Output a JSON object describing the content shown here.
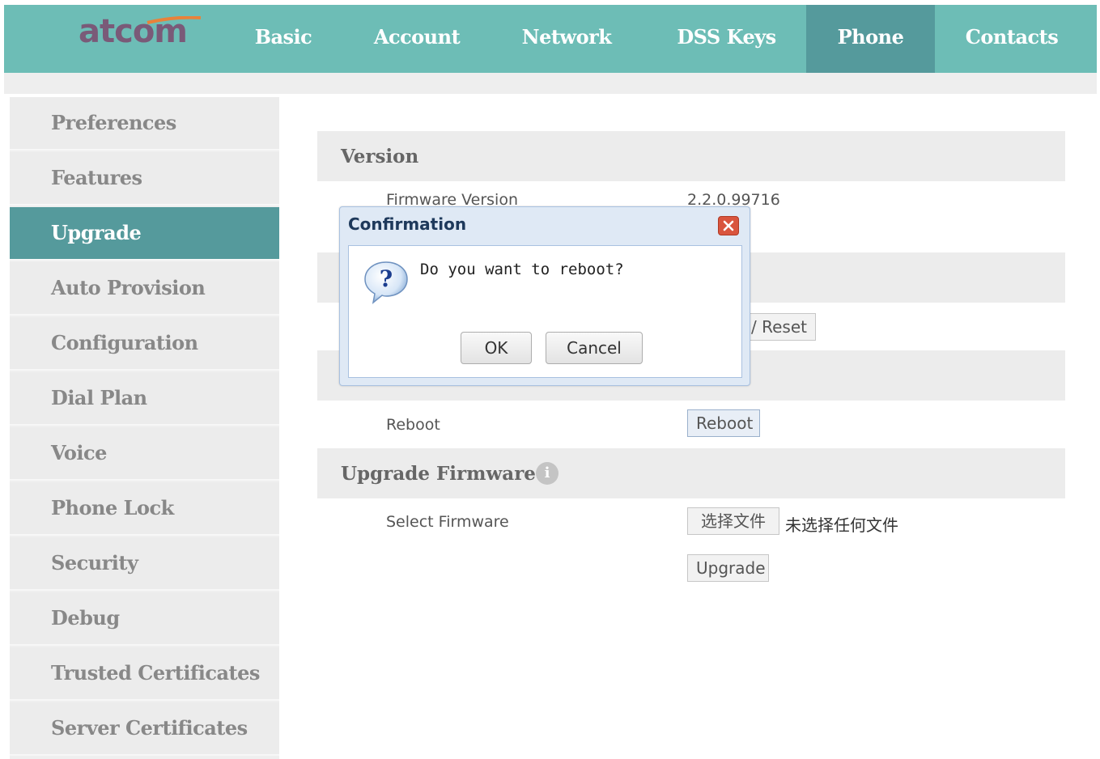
{
  "brand": {
    "logo_text": "atcom"
  },
  "nav": {
    "items": [
      {
        "label": "Basic"
      },
      {
        "label": "Account"
      },
      {
        "label": "Network"
      },
      {
        "label": "DSS Keys"
      },
      {
        "label": "Phone"
      },
      {
        "label": "Contacts"
      }
    ],
    "active": "Phone"
  },
  "sidebar": {
    "items": [
      {
        "label": "Preferences"
      },
      {
        "label": "Features"
      },
      {
        "label": "Upgrade"
      },
      {
        "label": "Auto Provision"
      },
      {
        "label": "Configuration"
      },
      {
        "label": "Dial Plan"
      },
      {
        "label": "Voice"
      },
      {
        "label": "Phone Lock"
      },
      {
        "label": "Security"
      },
      {
        "label": "Debug"
      },
      {
        "label": "Trusted Certificates"
      },
      {
        "label": "Server Certificates"
      }
    ],
    "active": "Upgrade"
  },
  "main": {
    "version": {
      "heading": "Version",
      "firmware_label": "Firmware Version",
      "firmware_value": "2.2.0.99716"
    },
    "reset": {
      "button_partial": "/ Reset"
    },
    "reboot": {
      "label": "Reboot",
      "button": "Reboot"
    },
    "upgrade_firmware": {
      "heading": "Upgrade Firmware",
      "info_icon": "info-icon",
      "select_label": "Select Firmware",
      "choose_file_button": "选择文件",
      "no_file_text": "未选择任何文件",
      "upgrade_button": "Upgrade"
    }
  },
  "dialog": {
    "title": "Confirmation",
    "icon": "question-icon",
    "message": "Do you want to reboot?",
    "ok_label": "OK",
    "cancel_label": "Cancel"
  },
  "colors": {
    "nav_bg": "#6dbdb6",
    "active_bg": "#559a9c",
    "logo": "#7a5a78",
    "close_red": "#d9553e"
  }
}
